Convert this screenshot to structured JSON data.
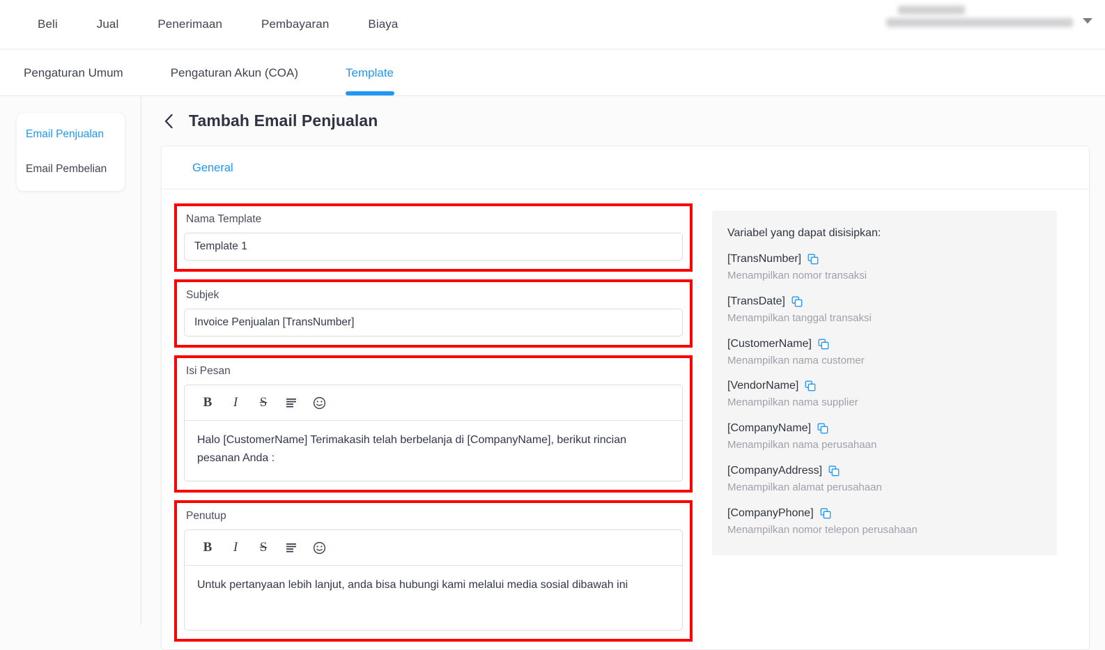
{
  "topnav": {
    "items": [
      {
        "label": "Beli"
      },
      {
        "label": "Jual"
      },
      {
        "label": "Penerimaan"
      },
      {
        "label": "Pembayaran"
      },
      {
        "label": "Biaya"
      }
    ]
  },
  "subtabs": {
    "items": [
      {
        "label": "Pengaturan Umum",
        "active": false
      },
      {
        "label": "Pengaturan Akun (COA)",
        "active": false
      },
      {
        "label": "Template",
        "active": true
      }
    ]
  },
  "sidebar": {
    "items": [
      {
        "label": "Email Penjualan",
        "active": true
      },
      {
        "label": "Email Pembelian",
        "active": false
      }
    ]
  },
  "page": {
    "title": "Tambah Email Penjualan",
    "card_tab": "General"
  },
  "form": {
    "nama_template": {
      "label": "Nama Template",
      "value": "Template 1",
      "placeholder": "Nama Template"
    },
    "subjek": {
      "label": "Subjek",
      "value": "Invoice Penjualan [TransNumber]",
      "placeholder": "Subjek"
    },
    "isi_pesan": {
      "label": "Isi Pesan",
      "value": "Halo [CustomerName] Terimakasih telah berbelanja di [CompanyName], berikut rincian pesanan Anda :"
    },
    "penutup": {
      "label": "Penutup",
      "value": "Untuk pertanyaan lebih lanjut, anda bisa hubungi kami melalui media sosial dibawah ini"
    }
  },
  "toolbar": {
    "bold": "B",
    "italic": "I",
    "strike": "S"
  },
  "variables": {
    "title": "Variabel yang dapat disisipkan:",
    "items": [
      {
        "name": "[TransNumber]",
        "desc": "Menampilkan nomor transaksi"
      },
      {
        "name": "[TransDate]",
        "desc": "Menampilkan tanggal transaksi"
      },
      {
        "name": "[CustomerName]",
        "desc": "Menampilkan nama customer"
      },
      {
        "name": "[VendorName]",
        "desc": "Menampilkan nama supplier"
      },
      {
        "name": "[CompanyName]",
        "desc": "Menampilkan nama perusahaan"
      },
      {
        "name": "[CompanyAddress]",
        "desc": "Menampilkan alamat perusahaan"
      },
      {
        "name": "[CompanyPhone]",
        "desc": "Menampilkan nomor telepon perusahaan"
      }
    ]
  },
  "colors": {
    "accent_blue": "#2196f3",
    "highlight_red": "#fb0000",
    "panel_gray": "#f5f5f5",
    "page_bg": "#fbfbfb"
  }
}
